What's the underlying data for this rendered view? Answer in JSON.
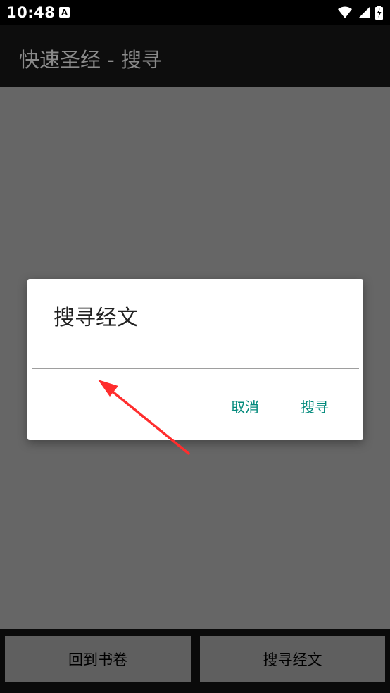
{
  "status_bar": {
    "time": "10:48",
    "notification_glyph": "A"
  },
  "app_bar": {
    "title": "快速圣经 - 搜寻"
  },
  "dialog": {
    "title": "搜寻经文",
    "input_value": "",
    "cancel_label": "取消",
    "confirm_label": "搜寻"
  },
  "bottom_bar": {
    "back_label": "回到书卷",
    "search_label": "搜寻经文"
  },
  "colors": {
    "accent": "#00897b",
    "annotation_arrow": "#ff2d2d"
  },
  "icons": [
    "wifi-icon",
    "cell-signal-icon",
    "battery-charging-icon",
    "notification-icon"
  ]
}
